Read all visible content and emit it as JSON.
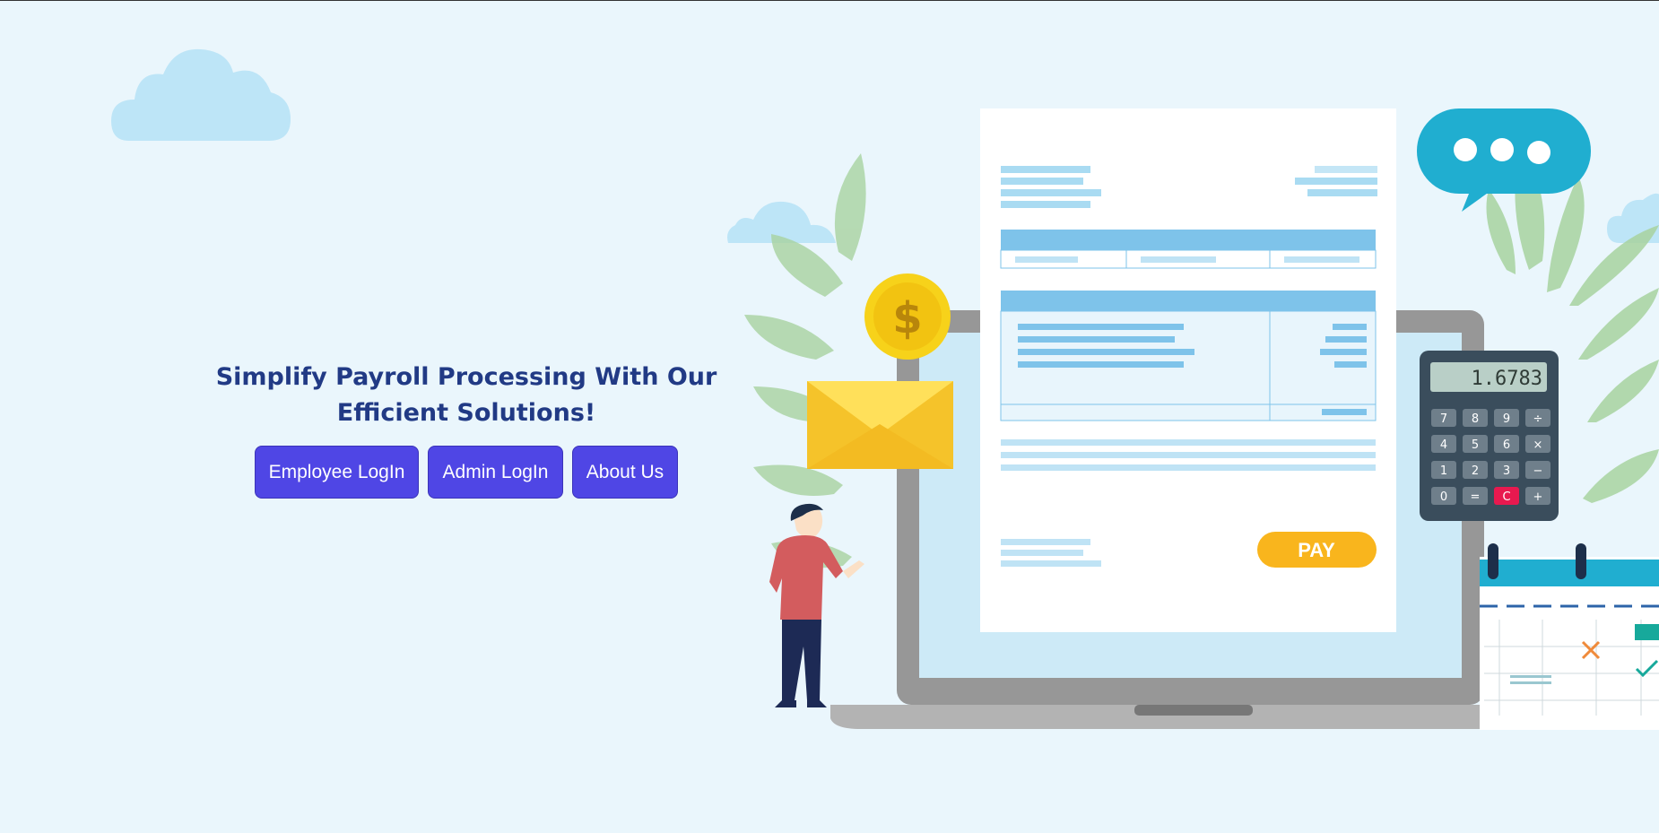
{
  "hero": {
    "headline_line1": "Simplify Payroll Processing With Our",
    "headline_line2": "Efficient Solutions!"
  },
  "buttons": {
    "employee_login": "Employee LogIn",
    "admin_login": "Admin LogIn",
    "about_us": "About Us"
  },
  "illustration": {
    "calculator_display": "1.6783",
    "calculator_keys": [
      "7",
      "8",
      "9",
      "÷",
      "4",
      "5",
      "6",
      "×",
      "1",
      "2",
      "3",
      "−",
      "0",
      "=",
      "C",
      "+"
    ],
    "pay_label": "PAY",
    "coin_symbol": "$"
  },
  "colors": {
    "background": "#eaf6fc",
    "headline": "#213a85",
    "button": "#4f46e5",
    "pay_button": "#f9b51d"
  }
}
